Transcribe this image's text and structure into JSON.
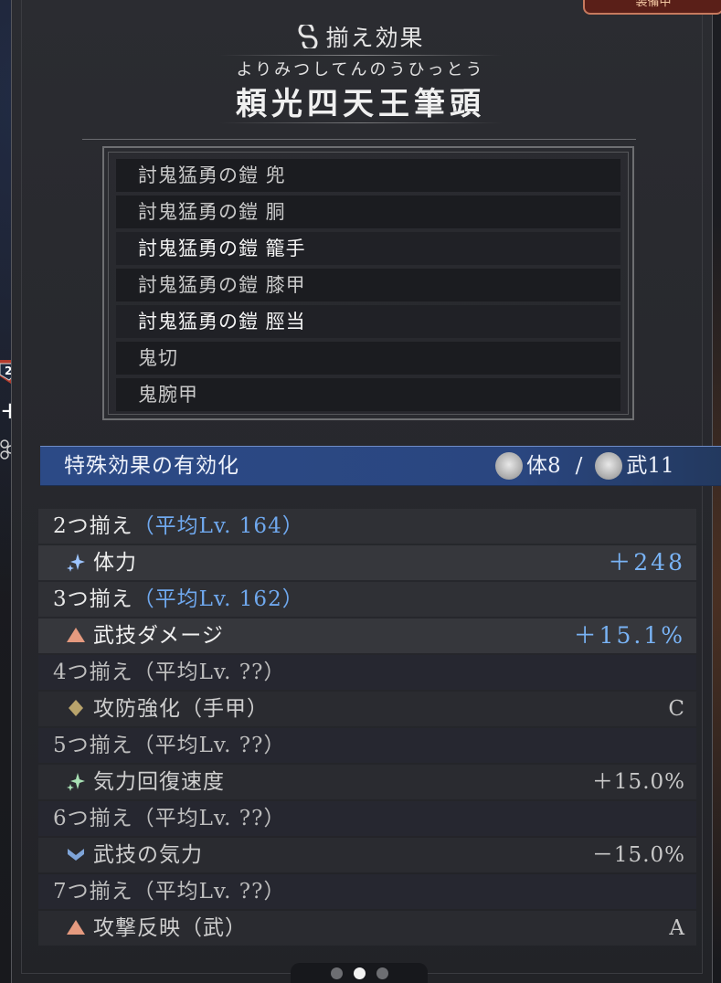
{
  "header": {
    "section_title": "揃え効果",
    "set_furigana": "よりみつしてんのうひっとう",
    "set_name": "頼光四天王筆頭",
    "top_right_button": "装備中"
  },
  "side": {
    "badge_number": "2",
    "plus": "+"
  },
  "equipment": [
    {
      "name": "討鬼猛勇の鎧 兜",
      "equipped": false
    },
    {
      "name": "討鬼猛勇の鎧 胴",
      "equipped": false
    },
    {
      "name": "討鬼猛勇の鎧 籠手",
      "equipped": true
    },
    {
      "name": "討鬼猛勇の鎧 膝甲",
      "equipped": false
    },
    {
      "name": "討鬼猛勇の鎧 脛当",
      "equipped": true
    },
    {
      "name": "鬼切",
      "equipped": false
    },
    {
      "name": "鬼腕甲",
      "equipped": false
    }
  ],
  "special": {
    "label": "特殊効果の有効化",
    "req1_label": "体8",
    "separator": "/",
    "req2_label": "武11"
  },
  "tiers": [
    {
      "count": "2つ揃え",
      "avg": "（平均Lv. 164）",
      "active": true,
      "effect": {
        "icon": "sparkle-blue-icon",
        "name": "体力",
        "value": "＋248"
      }
    },
    {
      "count": "3つ揃え",
      "avg": "（平均Lv. 162）",
      "active": true,
      "effect": {
        "icon": "triangle-up-orange-icon",
        "name": "武技ダメージ",
        "value": "＋15.1%"
      }
    },
    {
      "count": "4つ揃え",
      "avg": "（平均Lv. ??）",
      "active": false,
      "effect": {
        "icon": "diamond-gold-icon",
        "name": "攻防強化（手甲）",
        "value": "C"
      }
    },
    {
      "count": "5つ揃え",
      "avg": "（平均Lv. ??）",
      "active": false,
      "effect": {
        "icon": "sparkle-green-icon",
        "name": "気力回復速度",
        "value": "＋15.0%"
      }
    },
    {
      "count": "6つ揃え",
      "avg": "（平均Lv. ??）",
      "active": false,
      "effect": {
        "icon": "chevron-down-blue-icon",
        "name": "武技の気力",
        "value": "－15.0%"
      }
    },
    {
      "count": "7つ揃え",
      "avg": "（平均Lv. ??）",
      "active": false,
      "effect": {
        "icon": "triangle-up-orange-icon",
        "name": "攻撃反映（武）",
        "value": "A"
      }
    }
  ],
  "pagination": {
    "total": 3,
    "active_index": 1
  }
}
